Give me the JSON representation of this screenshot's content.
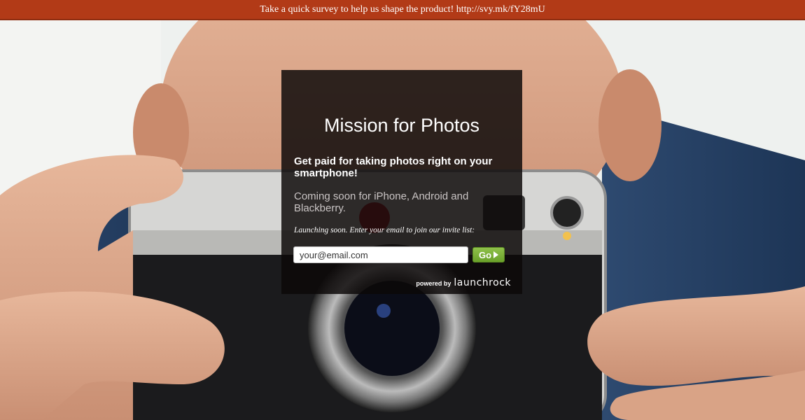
{
  "survey_bar": {
    "text": "Take a quick survey to help us shape the product! http://svy.mk/fY28mU"
  },
  "card": {
    "title": "Mission for Photos",
    "tagline": "Get paid for taking photos right on your smartphone!",
    "subtitle": "Coming soon for iPhone, Android and Blackberry.",
    "invite_text": "Launching soon. Enter your email to join our invite list:",
    "email_placeholder": "your@email.com",
    "go_label": "Go",
    "powered_by": "powered by",
    "powered_logo": "launchrock"
  },
  "colors": {
    "survey_bar": "#b23a17",
    "card_background": "#0c0808",
    "go_button": "#7bb23a"
  }
}
